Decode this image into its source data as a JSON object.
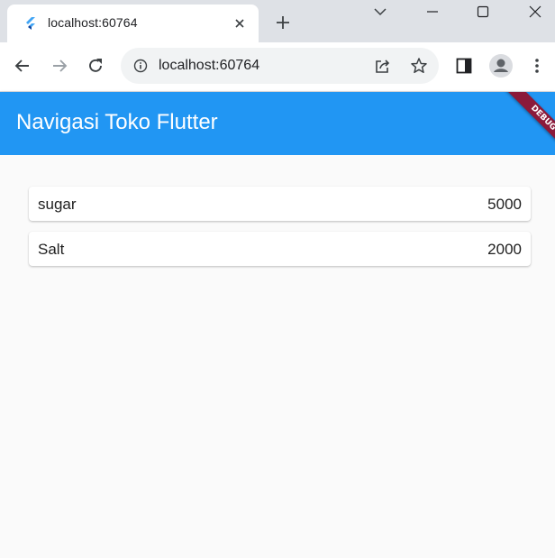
{
  "browser": {
    "tab": {
      "title": "localhost:60764",
      "favicon": "flutter-icon"
    },
    "address": "localhost:60764"
  },
  "app": {
    "title": "Navigasi Toko Flutter",
    "debug_banner": "DEBUG",
    "primary_color": "#2196f3",
    "items": [
      {
        "name": "sugar",
        "price": "5000"
      },
      {
        "name": "Salt",
        "price": "2000"
      }
    ]
  }
}
